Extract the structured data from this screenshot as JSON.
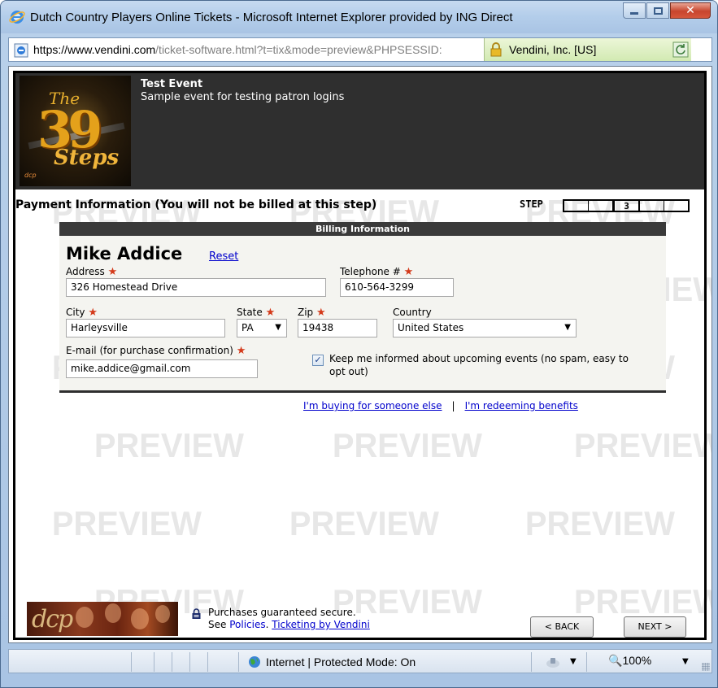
{
  "window": {
    "title": "Dutch Country Players Online Tickets - Microsoft Internet Explorer provided by ING Direct"
  },
  "address": {
    "proto": "https://www.",
    "domain": "vendini.com",
    "rest": "/ticket-software.html?t=tix&mode=preview&PHPSESSID:",
    "cert": "Vendini, Inc. [US]"
  },
  "event": {
    "title": "Test Event",
    "subtitle": "Sample event for testing patron logins"
  },
  "poster": {
    "the": "The",
    "number": "39",
    "steps": "Steps",
    "dcp": "dcp"
  },
  "watermark": "PREVIEW",
  "payment": {
    "heading": "Payment Information (You will not be billed at this step)",
    "step_label": "STEP",
    "steps": [
      "",
      "",
      "3",
      "",
      ""
    ],
    "current_step": 3
  },
  "billing": {
    "bar_title": "Billing Information",
    "name": "Mike Addice",
    "reset": "Reset",
    "address_label": "Address",
    "address": "326 Homestead Drive",
    "telephone_label": "Telephone #",
    "telephone": "610-564-3299",
    "city_label": "City",
    "city": "Harleysville",
    "state_label": "State",
    "state": "PA",
    "zip_label": "Zip",
    "zip": "19438",
    "country_label": "Country",
    "country": "United States",
    "email_label": "E-mail (for purchase confirmation)",
    "email": "mike.addice@gmail.com",
    "newsletter_text": "Keep me informed about upcoming events (no spam, easy to opt out)",
    "newsletter_checked": true,
    "required_mark": "★"
  },
  "links": {
    "someone_else": "I'm buying for someone else",
    "separator": "|",
    "redeeming": "I'm redeeming benefits"
  },
  "footer": {
    "logo_text": "dcp",
    "secure_text": "Purchases guaranteed secure.",
    "see": "See ",
    "policies": "Policies",
    "dot": ".",
    "ticketing": "Ticketing by Vendini",
    "back": "< BACK",
    "next": "NEXT >"
  },
  "statusbar": {
    "zone": "Internet | Protected Mode: On",
    "zoom": "100%"
  },
  "colors": {
    "link": "#0000cc",
    "required": "#d43a1a",
    "header_bg": "#2f2f2f"
  },
  "icons": [
    "ie-logo-icon",
    "page-icon",
    "lock-icon",
    "refresh-icon",
    "padlock-icon",
    "globe-icon",
    "zoom-icon",
    "security-icon"
  ]
}
